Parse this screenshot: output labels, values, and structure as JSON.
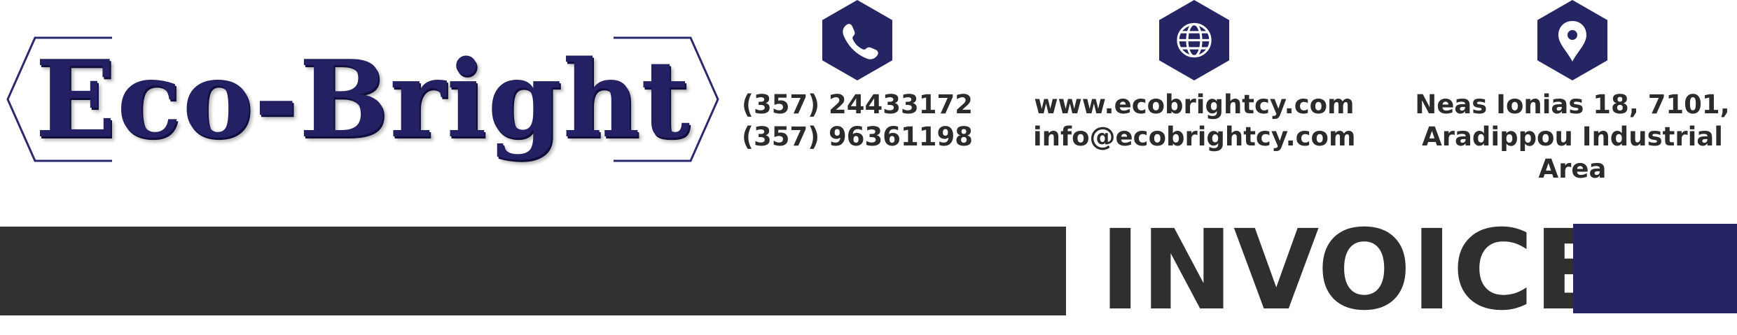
{
  "brand": {
    "name": "Eco-Bright",
    "color": "#262564"
  },
  "contacts": [
    {
      "icon": "phone-icon",
      "lines": [
        "(357) 24433172",
        "(357) 96361198"
      ]
    },
    {
      "icon": "globe-icon",
      "lines": [
        "www.ecobrightcy.com",
        "info@ecobrightcy.com"
      ]
    },
    {
      "icon": "map-pin-icon",
      "lines": [
        "Neas Ionias 18, 7101,",
        "Aradippou Industrial",
        "Area"
      ]
    }
  ],
  "document": {
    "title": "INVOICE"
  },
  "colors": {
    "accent": "#262564",
    "dark_bar": "#323232",
    "text": "#2b2b2b"
  }
}
